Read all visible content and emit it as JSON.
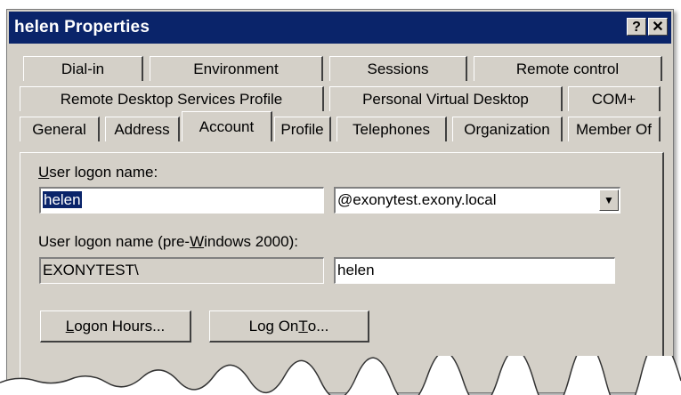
{
  "window": {
    "title": "helen Properties",
    "help_glyph": "?",
    "close_glyph": "✕"
  },
  "tabs": {
    "row1": [
      "Dial-in",
      "Environment",
      "Sessions",
      "Remote control"
    ],
    "row2": [
      "Remote Desktop Services Profile",
      "Personal Virtual Desktop",
      "COM+"
    ],
    "row3": [
      "General",
      "Address",
      "Account",
      "Profile",
      "Telephones",
      "Organization",
      "Member Of"
    ],
    "active": "Account"
  },
  "account": {
    "logon_name_label_prefix": "U",
    "logon_name_label_rest": "ser logon name:",
    "logon_name_value": "helen",
    "domain_value": "@exonytest.exony.local",
    "pre2000_label_a": "User logon name (pre-",
    "pre2000_label_u": "W",
    "pre2000_label_b": "indows 2000):",
    "pre2000_domain": "EXONYTEST\\",
    "pre2000_name": "helen",
    "logon_hours_u": "L",
    "logon_hours_rest": "ogon Hours...",
    "logon_to_a": "Log On ",
    "logon_to_u": "T",
    "logon_to_b": "o..."
  },
  "colors": {
    "titlebar": "#0a246a",
    "dialog_face": "#d4d0c8"
  },
  "icons": {
    "dropdown": "chevron-down-icon"
  }
}
